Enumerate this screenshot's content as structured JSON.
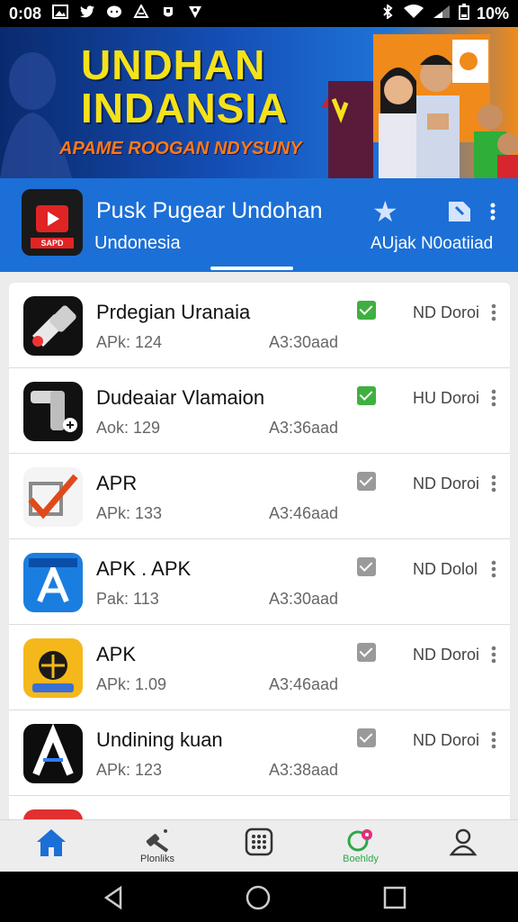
{
  "status_bar": {
    "time": "0:08",
    "battery": "10%"
  },
  "banner": {
    "title_line1": "UNDHAN",
    "title_line2": "INDANSIA",
    "subtitle": "APAME ROOGAN NDYSUNY"
  },
  "app_header": {
    "name": "Pusk Pugear Undohan",
    "subtitle": "Undonesia",
    "icon_label": "SAPD",
    "action_label": "AUjak N0oatiiad"
  },
  "list": {
    "items": [
      {
        "name": "Prdegian Uranaia",
        "meta": "APk: 124",
        "time": "A3:30aad",
        "status": "ND Doroi",
        "checked": true,
        "icon": "tool-icon"
      },
      {
        "name": "Dudeaiar Vlamaion",
        "meta": "Aok: 129",
        "time": "A3:36aad",
        "status": "HU Doroi",
        "checked": true,
        "icon": "pipe-icon"
      },
      {
        "name": "APR",
        "meta": "APk: 133",
        "time": "A3:46aad",
        "status": "ND Doroi",
        "checked": false,
        "icon": "checkmark-icon"
      },
      {
        "name": "APK . APK",
        "meta": "Pak: 113",
        "time": "A3:30aad",
        "status": "ND Dolol",
        "checked": false,
        "icon": "appstore-icon"
      },
      {
        "name": "APK",
        "meta": "APk: 1.09",
        "time": "A3:46aad",
        "status": "ND Doroi",
        "checked": false,
        "icon": "badge-icon"
      },
      {
        "name": "Undining kuan",
        "meta": "APk: 123",
        "time": "A3:38aad",
        "status": "ND Doroi",
        "checked": false,
        "icon": "letter-a-icon"
      }
    ]
  },
  "bottom_nav": {
    "items": [
      {
        "label": "",
        "icon": "home-icon",
        "active": true
      },
      {
        "label": "Plonliks",
        "icon": "hammer-icon",
        "active": false
      },
      {
        "label": "",
        "icon": "grid-icon",
        "active": false
      },
      {
        "label": "Boehldy",
        "icon": "gamepad-icon",
        "active": false
      },
      {
        "label": "",
        "icon": "person-icon",
        "active": false
      }
    ]
  },
  "colors": {
    "header_blue": "#1c6fd6",
    "check_green": "#3fb03f",
    "check_gray": "#9a9a9a",
    "nav_active": "#1c6fd6",
    "banner_yellow": "#f5e21a"
  }
}
